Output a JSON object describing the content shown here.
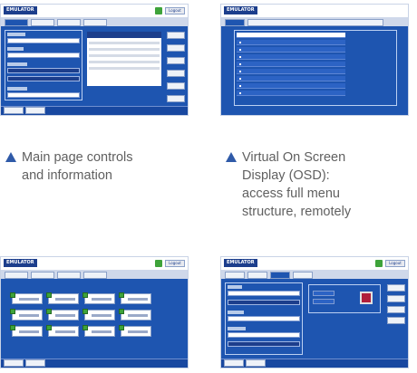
{
  "app": {
    "title_text": "EMULATOR",
    "logout_label": "Logout",
    "accent": "#1e55b0",
    "indicator_green": "#3ea33a",
    "indicator_red": "#b01e3a"
  },
  "captions": [
    {
      "icon": "triangle-up-icon",
      "lines": [
        "Main page controls",
        "and information"
      ]
    },
    {
      "icon": "triangle-up-icon",
      "lines": [
        "Virtual On Screen",
        "Display (OSD):",
        "access full menu",
        "structure, remotely"
      ]
    }
  ],
  "caption_color": "#2f5aa8"
}
